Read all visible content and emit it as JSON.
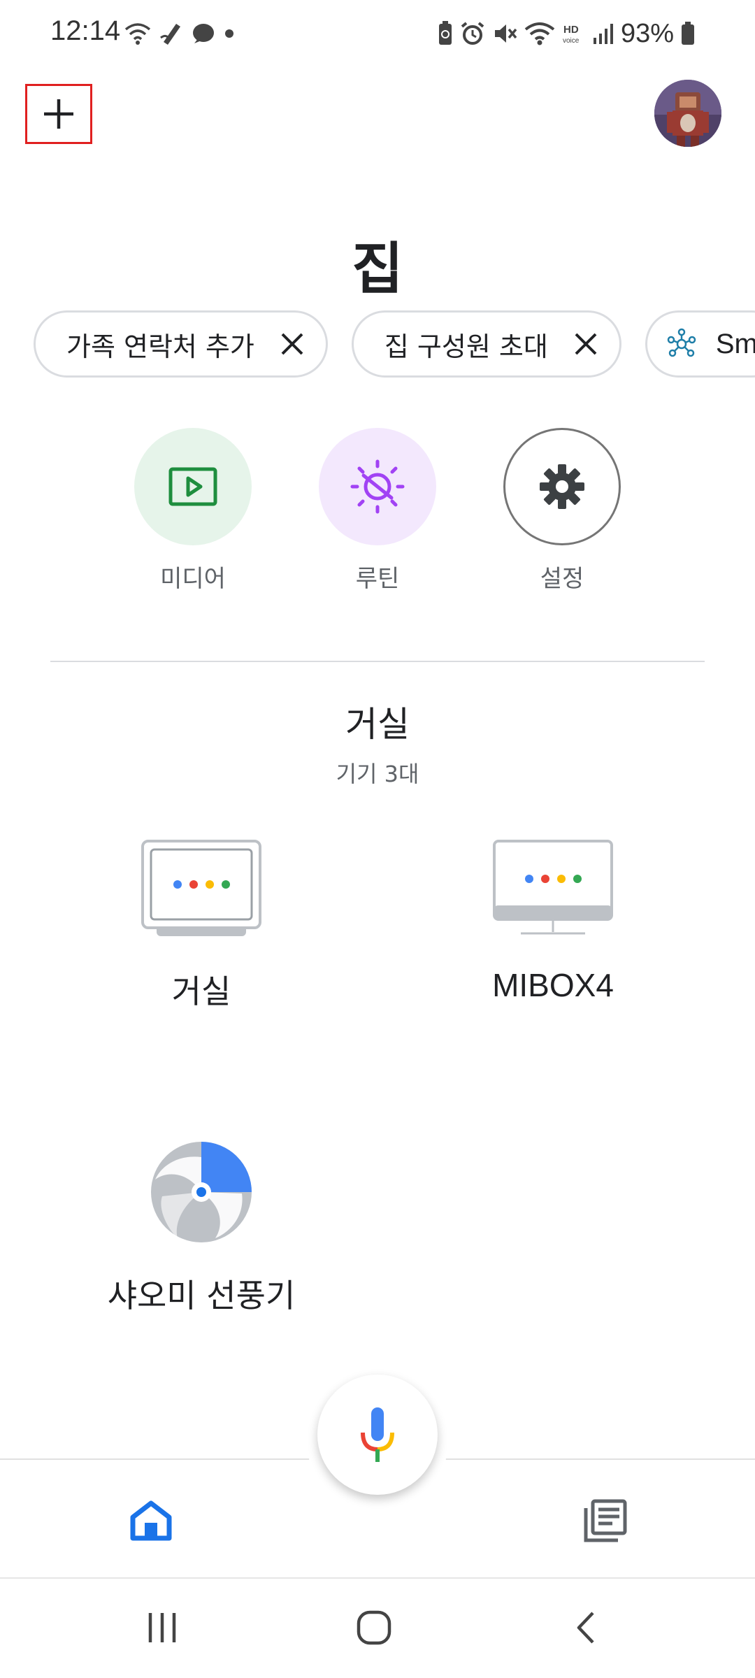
{
  "status_bar": {
    "time": "12:14",
    "battery": "93%",
    "left_icons": [
      "wifi-icon",
      "pen-icon",
      "chat-bubble-icon",
      "dot-icon"
    ],
    "right_icons": [
      "battery-saver-icon",
      "alarm-icon",
      "mute-icon",
      "wifi-icon",
      "hd-voice-icon",
      "signal-icon",
      "battery-icon"
    ]
  },
  "header": {
    "add_icon": "plus-icon",
    "avatar": "profile-avatar",
    "title": "집"
  },
  "chips": [
    {
      "label": "가족 연락처 추가",
      "icon": "close-icon"
    },
    {
      "label": "집 구성원 초대",
      "icon": "close-icon"
    },
    {
      "label": "Sm",
      "icon": "hub-icon"
    }
  ],
  "quick_actions": [
    {
      "label": "미디어",
      "icon": "play-icon",
      "color": "#e6f4ea"
    },
    {
      "label": "루틴",
      "icon": "routine-sun-icon",
      "color": "#f3e8fd"
    },
    {
      "label": "설정",
      "icon": "gear-icon",
      "color": "#ffffff"
    }
  ],
  "room": {
    "name": "거실",
    "count": "기기 3대"
  },
  "devices": [
    {
      "label": "거실",
      "icon": "nest-hub-icon"
    },
    {
      "label": "MIBOX4",
      "icon": "tv-icon"
    },
    {
      "label": "샤오미 선풍기",
      "icon": "fan-icon"
    }
  ],
  "bottom_nav": {
    "home_icon": "home-icon",
    "feed_icon": "feed-icon",
    "mic_icon": "mic-icon",
    "accent": "#1a73e8"
  },
  "system_nav": [
    "recents-icon",
    "home-circle-icon",
    "back-icon"
  ]
}
